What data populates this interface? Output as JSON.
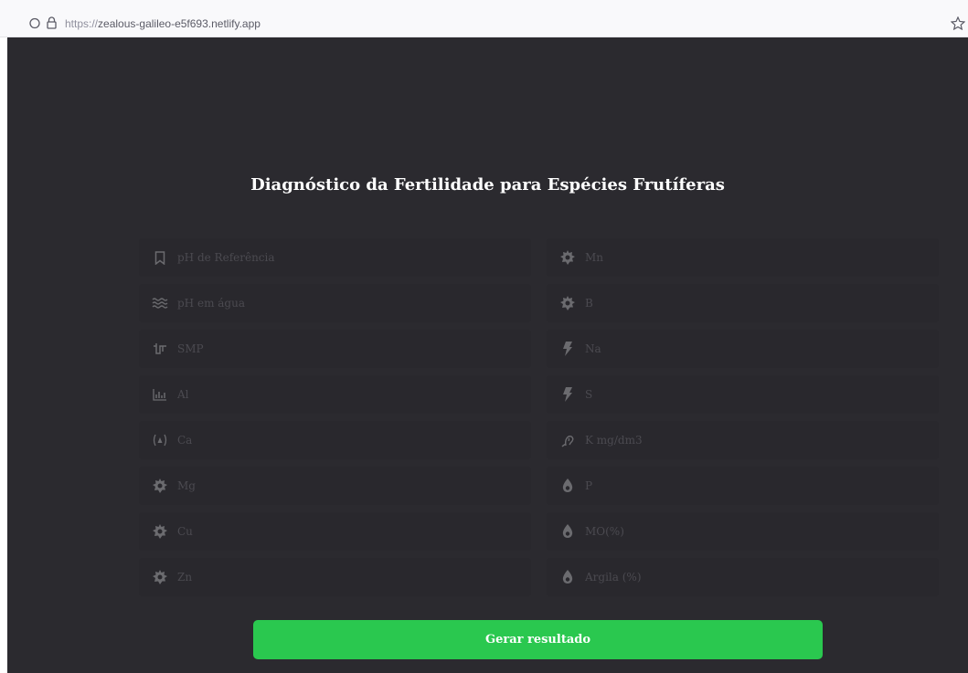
{
  "browser": {
    "url_prefix": "https://",
    "url_host": "zealous-galileo-e5f693.netlify.app"
  },
  "page": {
    "title": "Diagnóstico da Fertilidade para Espécies Frutíferas"
  },
  "form": {
    "left": [
      {
        "placeholder": "pH de Referência",
        "icon": "bookmark-icon"
      },
      {
        "placeholder": "pH em água",
        "icon": "water-icon"
      },
      {
        "placeholder": "SMP",
        "icon": "pulse-icon"
      },
      {
        "placeholder": "Al",
        "icon": "chart-icon"
      },
      {
        "placeholder": "Ca",
        "icon": "atom-icon"
      },
      {
        "placeholder": "Mg",
        "icon": "gear-icon"
      },
      {
        "placeholder": "Cu",
        "icon": "gear-icon"
      },
      {
        "placeholder": "Zn",
        "icon": "gear-icon"
      }
    ],
    "right": [
      {
        "placeholder": "Mn",
        "icon": "gear-icon"
      },
      {
        "placeholder": "B",
        "icon": "gear-icon"
      },
      {
        "placeholder": "Na",
        "icon": "bolt-icon"
      },
      {
        "placeholder": "S",
        "icon": "bolt-icon"
      },
      {
        "placeholder": "K mg/dm3",
        "icon": "hearing-icon"
      },
      {
        "placeholder": "P",
        "icon": "drop-icon"
      },
      {
        "placeholder": "MO(%)",
        "icon": "drop-icon"
      },
      {
        "placeholder": "Argila (%)",
        "icon": "drop-icon"
      }
    ],
    "submit_label": "Gerar resultado"
  },
  "colors": {
    "background": "#2b2a2f",
    "field": "#29282d",
    "button": "#2ac84f"
  }
}
